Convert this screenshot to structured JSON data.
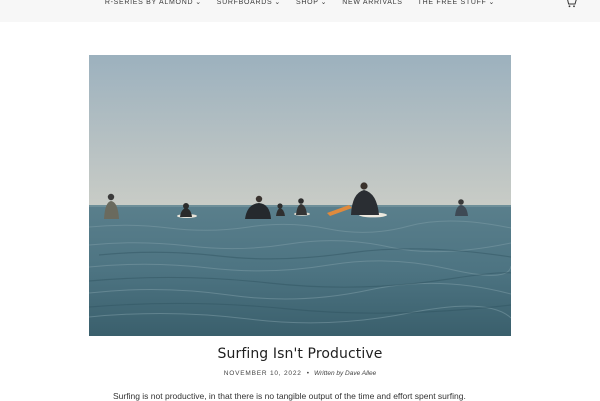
{
  "nav": {
    "items": [
      {
        "label": "R-SERIES BY ALMOND",
        "has_dropdown": true
      },
      {
        "label": "SURFBOARDS",
        "has_dropdown": true
      },
      {
        "label": "SHOP",
        "has_dropdown": true
      },
      {
        "label": "NEW ARRIVALS",
        "has_dropdown": false
      },
      {
        "label": "THE FREE STUFF",
        "has_dropdown": true
      }
    ],
    "chevron": "⌄",
    "cart_icon": "cart-icon"
  },
  "article": {
    "title": "Surfing Isn't Productive",
    "date": "NOVEMBER 10, 2022",
    "separator": "•",
    "author": "Written by Dave Allee",
    "excerpt": "Surfing is not productive, in that there is no tangible output of the time and effort spent surfing."
  },
  "colors": {
    "sky_top": "#9fb3bf",
    "sky_bottom": "#c8ccc7",
    "sea_top": "#5f8592",
    "sea_bottom": "#3f6674",
    "nav_bg": "#f7f7f7"
  }
}
